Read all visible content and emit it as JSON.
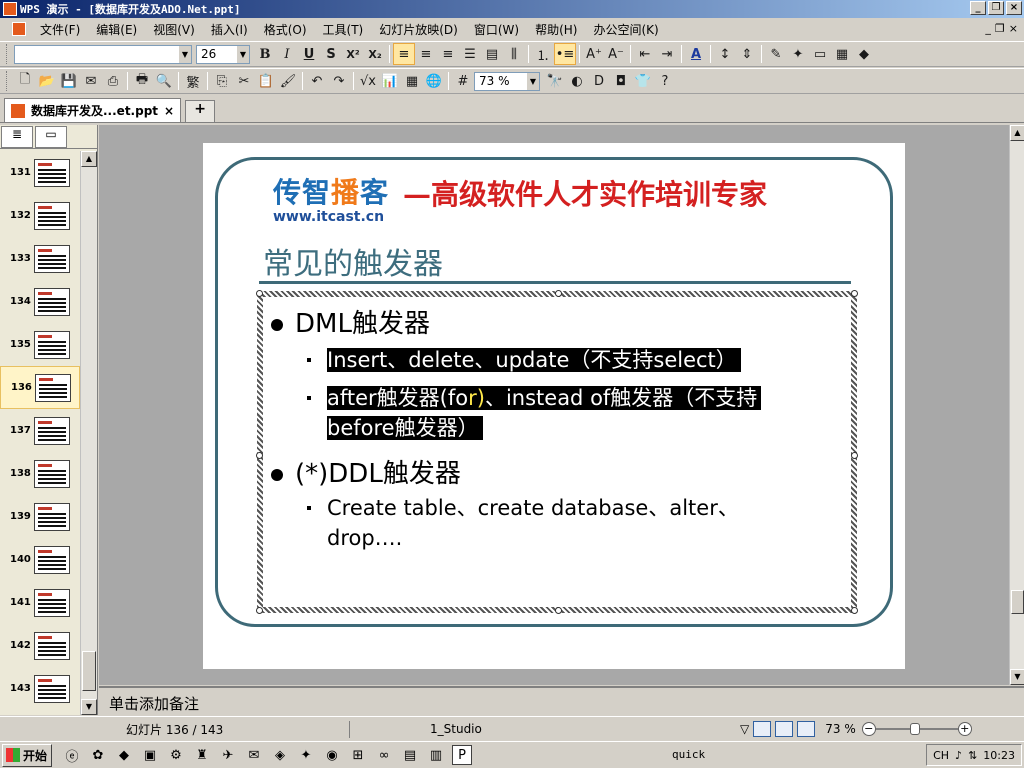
{
  "window": {
    "title": "WPS 演示 - [数据库开发及ADO.Net.ppt]"
  },
  "menu": {
    "items": [
      "文件(F)",
      "编辑(E)",
      "视图(V)",
      "插入(I)",
      "格式(O)",
      "工具(T)",
      "幻灯片放映(D)",
      "窗口(W)",
      "帮助(H)",
      "办公空间(K)"
    ]
  },
  "format_toolbar": {
    "font_name": "",
    "font_size": "26",
    "bold": "B",
    "italic": "I",
    "underline": "U",
    "shadow": "S",
    "superscript": "X²",
    "subscript": "X₂"
  },
  "standard_toolbar": {
    "zoom": "73 %"
  },
  "doc_tab": {
    "label": "数据库开发及...et.ppt",
    "close": "×",
    "add": "+"
  },
  "slides_panel": {
    "thumbnails": [
      {
        "num": "131"
      },
      {
        "num": "132"
      },
      {
        "num": "133"
      },
      {
        "num": "134"
      },
      {
        "num": "135"
      },
      {
        "num": "136"
      },
      {
        "num": "137"
      },
      {
        "num": "138"
      },
      {
        "num": "139"
      },
      {
        "num": "140"
      },
      {
        "num": "141"
      },
      {
        "num": "142"
      },
      {
        "num": "143"
      }
    ]
  },
  "slide": {
    "logo_part1": "传智",
    "logo_part2": "播",
    "logo_part3": "客",
    "logo_url": "www.itcast.cn",
    "slogan": "—高级软件人才实作培训专家",
    "title": "常见的触发器",
    "bullets": {
      "b1": "DML触发器",
      "b1_sub1": "Insert、delete、update（不支持select）",
      "b1_sub2_a": "after触发器(fo",
      "b1_sub2_b": "r)",
      "b1_sub2_c": "、instead of触发器（不支持",
      "b1_sub2_d": "before触发器）",
      "b2": "(*)DDL触发器",
      "b2_sub1": "Create table、create database、alter、",
      "b2_sub1_cont": "drop…."
    }
  },
  "notes": {
    "placeholder": "单击添加备注"
  },
  "status": {
    "slide_count": "幻灯片 136 / 143",
    "theme": "1_Studio",
    "zoom": "73 %"
  },
  "taskbar": {
    "start": "开始",
    "quick": "quick",
    "ime": "CH",
    "clock": "10:23"
  }
}
